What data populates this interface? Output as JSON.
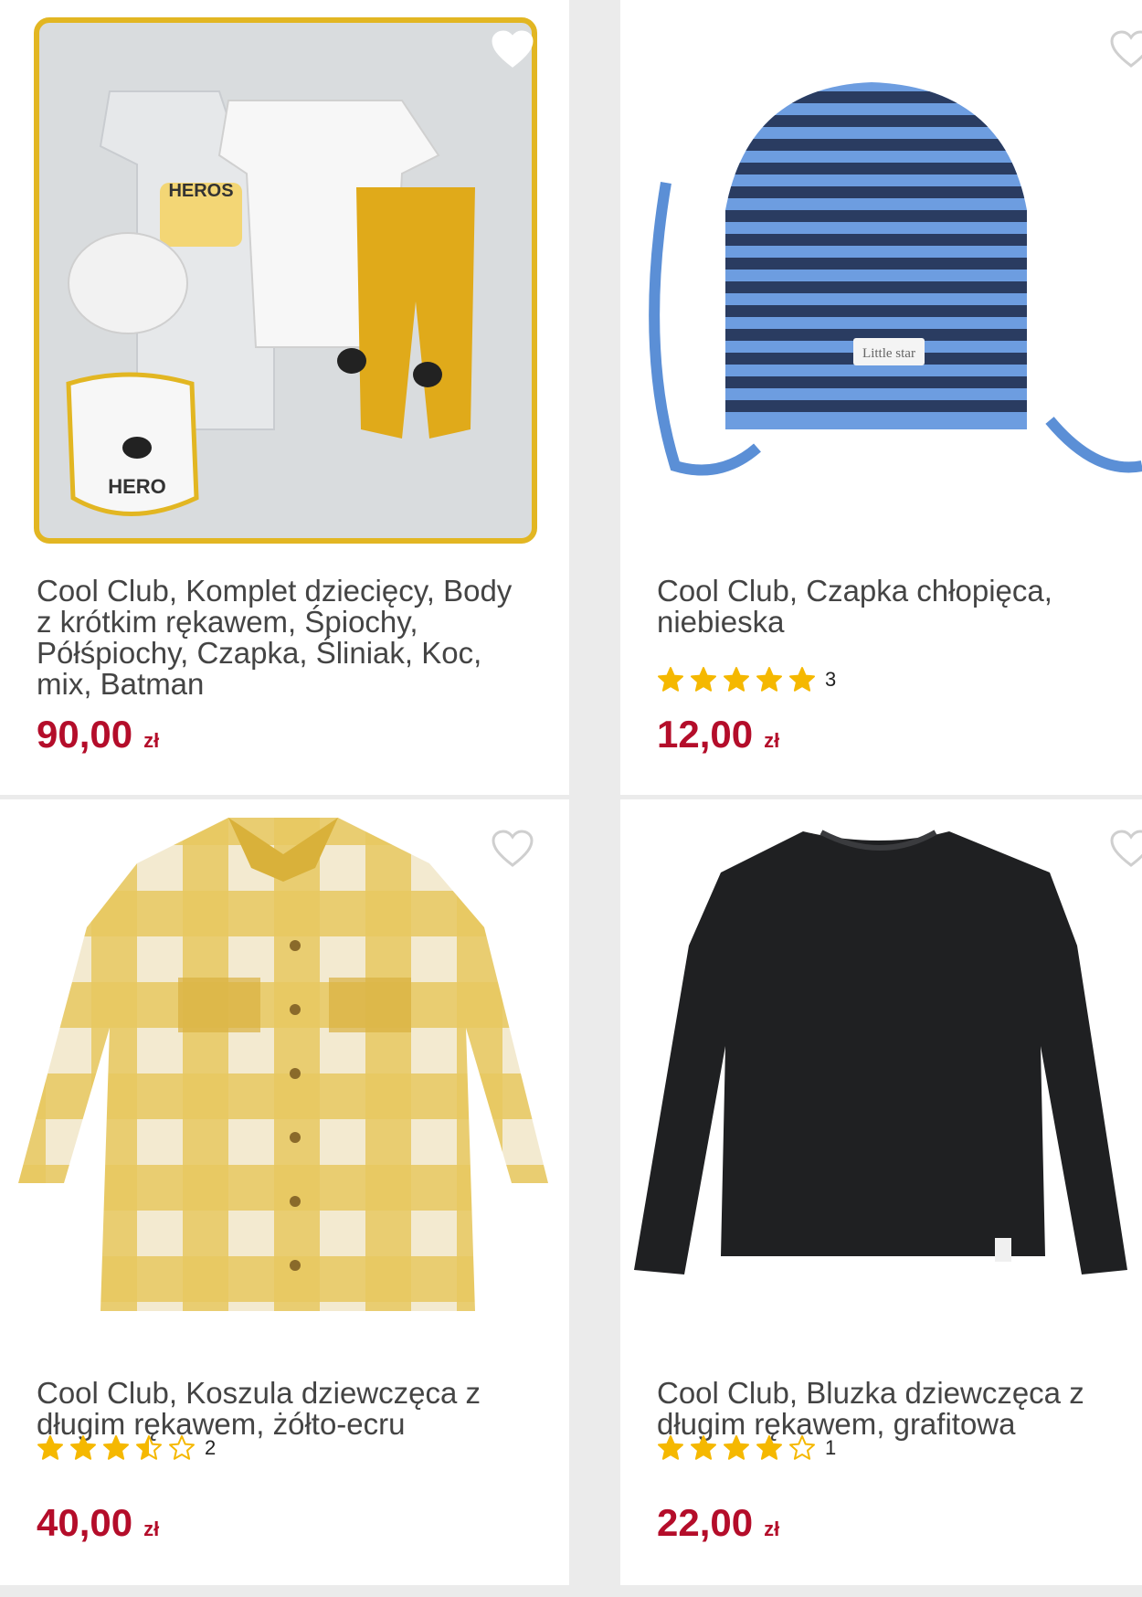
{
  "colors": {
    "price": "#b40d2a",
    "star": "#f5b800",
    "star_empty": "#f5b800"
  },
  "products": [
    {
      "title": "Cool Club, Komplet dziecięcy, Body z krótkim rękawem, Śpiochy, Półśpiochy, Czapka, Śliniak, Koc, mix, Batman",
      "price": "90,00",
      "currency": "zł",
      "rating": null,
      "rating_count": null,
      "image_icon": "baby-batman-set",
      "wishlist_icon": "heart-outline-icon"
    },
    {
      "title": "Cool Club, Czapka chłopięca, niebieska",
      "price": "12,00",
      "currency": "zł",
      "rating": 5,
      "rating_count": "3",
      "image_icon": "striped-hat",
      "wishlist_icon": "heart-outline-icon"
    },
    {
      "title": "Cool Club, Koszula dziewczęca z długim rękawem, żółto-ecru",
      "price": "40,00",
      "currency": "zł",
      "rating": 3.5,
      "rating_count": "2",
      "image_icon": "yellow-checked-shirt",
      "wishlist_icon": "heart-outline-icon"
    },
    {
      "title": "Cool Club, Bluzka dziewczęca z długim rękawem, grafitowa",
      "price": "22,00",
      "currency": "zł",
      "rating": 4,
      "rating_count": "1",
      "image_icon": "graphite-longsleeve",
      "wishlist_icon": "heart-outline-icon"
    }
  ]
}
